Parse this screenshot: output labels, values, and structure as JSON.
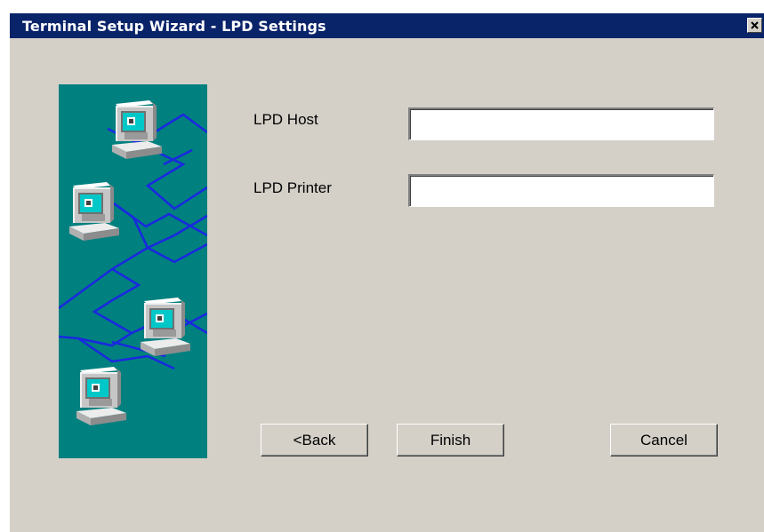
{
  "window": {
    "title": "Terminal Setup Wizard - LPD Settings",
    "close_icon": "close-icon",
    "accent": "#0a246a"
  },
  "art": {
    "description_icon": "network-computers-illustration",
    "background": "#00807f",
    "network_line_color": "#1a28e0"
  },
  "form": {
    "host_label": "LPD Host",
    "host_value": "",
    "printer_label": "LPD Printer",
    "printer_value": ""
  },
  "buttons": {
    "back": "<Back",
    "finish": "Finish",
    "cancel": "Cancel"
  }
}
